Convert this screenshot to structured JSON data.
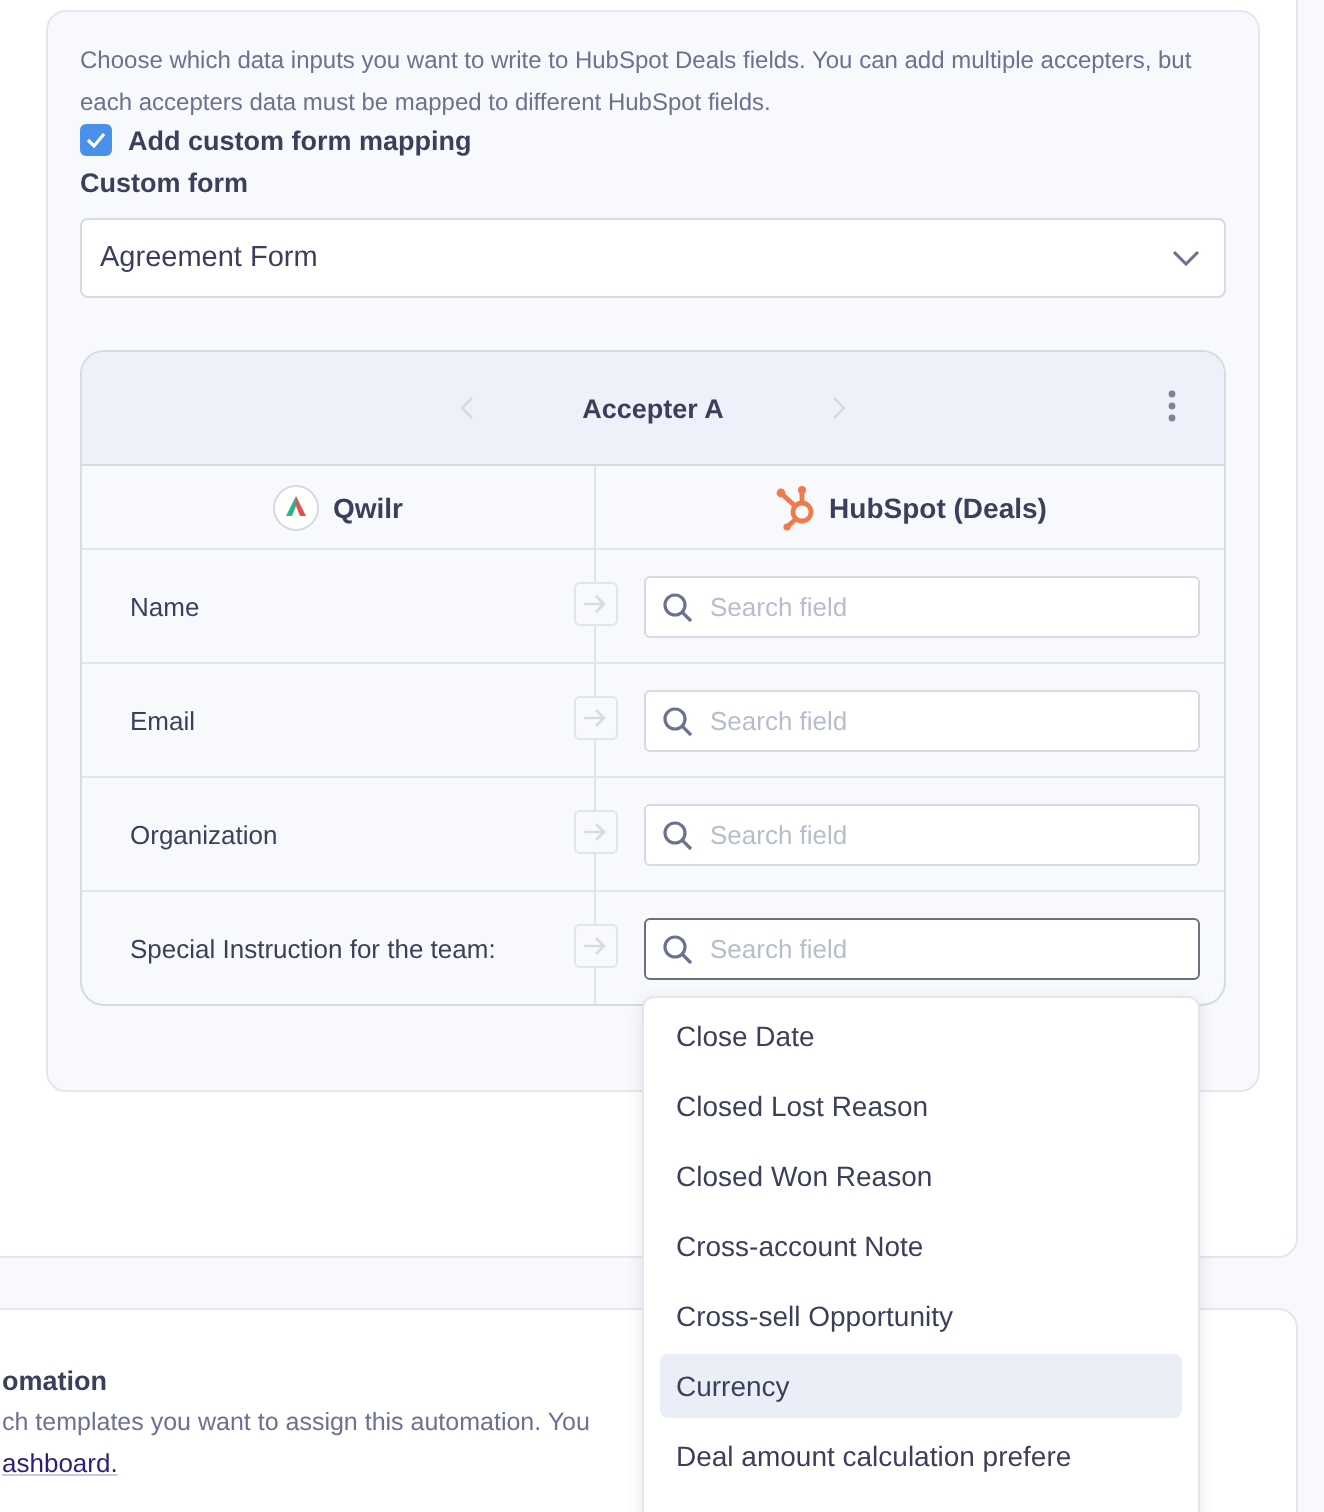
{
  "intro": {
    "description": "Choose which data inputs you want to write to HubSpot Deals fields. You can add multiple accepters, but each accepters data must be mapped to different HubSpot fields.",
    "checkbox": {
      "label": "Add custom form mapping",
      "checked": true
    },
    "custom_form": {
      "label": "Custom form",
      "value": "Agreement Form"
    }
  },
  "mapping": {
    "accepter": "Accepter A",
    "columns": [
      {
        "kind": "qwilr",
        "label": "Qwilr"
      },
      {
        "kind": "hubspot",
        "label": "HubSpot (Deals)"
      }
    ],
    "rows": [
      {
        "field": "Name",
        "placeholder": "Search field",
        "focused": false
      },
      {
        "field": "Email",
        "placeholder": "Search field",
        "focused": false
      },
      {
        "field": "Organization",
        "placeholder": "Search field",
        "focused": false
      },
      {
        "field": "Special Instruction for the team:",
        "placeholder": "Search field",
        "focused": true
      }
    ]
  },
  "dropdown": {
    "options": [
      {
        "label": "Close Date",
        "selected": false
      },
      {
        "label": "Closed Lost Reason",
        "selected": false
      },
      {
        "label": "Closed Won Reason",
        "selected": false
      },
      {
        "label": "Cross-account Note",
        "selected": false
      },
      {
        "label": "Cross-sell Opportunity",
        "selected": false
      },
      {
        "label": "Currency",
        "selected": true
      },
      {
        "label": "Deal amount calculation prefere",
        "selected": false
      }
    ]
  },
  "automation": {
    "title": "omation",
    "description": "ch templates you want to assign this automation. You",
    "link": "ashboard."
  }
}
